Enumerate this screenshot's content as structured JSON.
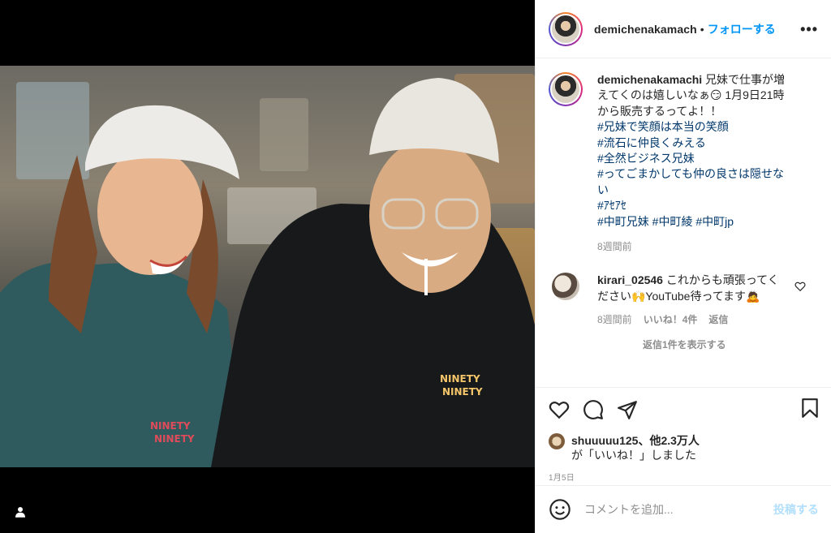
{
  "header": {
    "username": "demichenakamach",
    "separator": "•",
    "follow_label": "フォローする",
    "more_label": "•••"
  },
  "caption": {
    "username": "demichenakamachi",
    "text": "兄妹で仕事が増えてくのは嬉しいなぁ😏 1月9日21時から販売するってよ！！",
    "hashtags": [
      "#兄妹で笑顔は本当の笑顔",
      "#流石に仲良くみえる",
      "#全然ビジネス兄妹",
      "#ってごまかしても仲の良さは隠せない",
      "#ｱｾｱｾ",
      "#中町兄妹 #中町綾 #中町jp"
    ],
    "time": "8週間前"
  },
  "comment": {
    "username": "kirari_02546",
    "text": "これからも頑張ってください🙌YouTube待ってます🙇",
    "time": "8週間前",
    "likes": "いいね！4件",
    "reply": "返信",
    "replies_label": "返信1件を表示する"
  },
  "likes": {
    "user": "shuuuuu125",
    "others": "、他2.3万人",
    "suffix": "が「いいね！」しました"
  },
  "date": "1月5日",
  "add_comment": {
    "placeholder": "コメントを追加...",
    "post_label": "投稿する"
  },
  "icons": {
    "like": "heart-icon",
    "comment": "comment-icon",
    "share": "paper-plane-icon",
    "save": "bookmark-icon",
    "emoji": "emoji-icon",
    "user_tag": "user-icon"
  },
  "colors": {
    "accent": "#0095f6",
    "hashtag": "#00376b",
    "muted": "#8e8e8e",
    "post_disabled": "#b2dffc"
  }
}
